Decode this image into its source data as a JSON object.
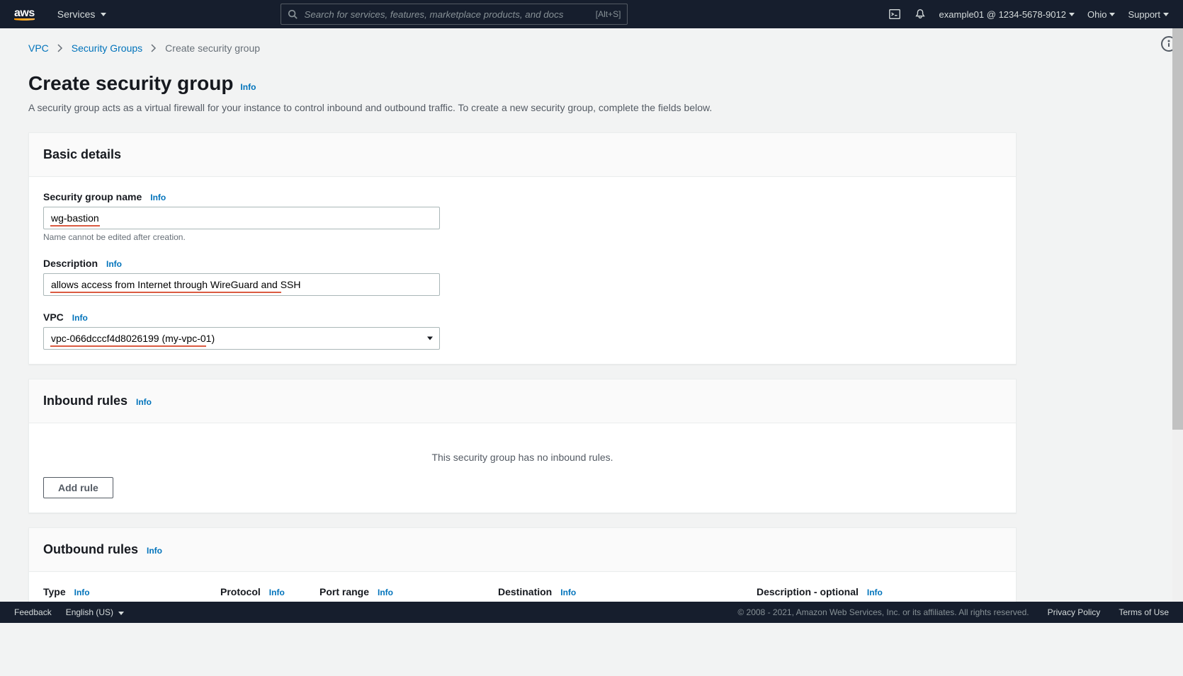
{
  "header": {
    "services_label": "Services",
    "search_placeholder": "Search for services, features, marketplace products, and docs",
    "search_kbd": "[Alt+S]",
    "account": "example01 @ 1234-5678-9012",
    "region": "Ohio",
    "support": "Support"
  },
  "breadcrumbs": {
    "items": [
      "VPC",
      "Security Groups",
      "Create security group"
    ]
  },
  "page": {
    "title": "Create security group",
    "subtitle": "A security group acts as a virtual firewall for your instance to control inbound and outbound traffic. To create a new security group, complete the fields below."
  },
  "info_label": "Info",
  "basic": {
    "panel_title": "Basic details",
    "name_label": "Security group name",
    "name_value": "wg-bastion",
    "name_hint": "Name cannot be edited after creation.",
    "desc_label": "Description",
    "desc_value": "allows access from Internet through WireGuard and SSH",
    "vpc_label": "VPC",
    "vpc_value": "vpc-066dcccf4d8026199 (my-vpc-01)"
  },
  "inbound": {
    "panel_title": "Inbound rules",
    "empty_msg": "This security group has no inbound rules.",
    "add_rule_label": "Add rule"
  },
  "outbound": {
    "panel_title": "Outbound rules",
    "columns": {
      "type": "Type",
      "protocol": "Protocol",
      "port_range": "Port range",
      "destination": "Destination",
      "description": "Description - optional"
    }
  },
  "footer": {
    "feedback": "Feedback",
    "language": "English (US)",
    "copyright": "© 2008 - 2021, Amazon Web Services, Inc. or its affiliates. All rights reserved.",
    "privacy": "Privacy Policy",
    "terms": "Terms of Use"
  }
}
